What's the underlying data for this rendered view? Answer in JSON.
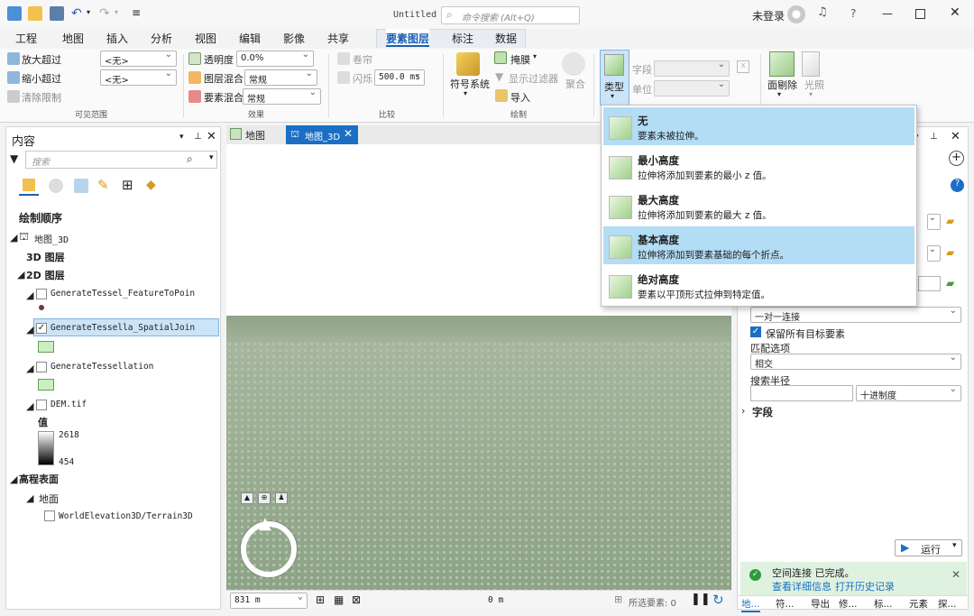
{
  "window": {
    "title": "Untitled",
    "search_placeholder": "命令搜索 (Alt+Q)",
    "user": "未登录"
  },
  "tabs": [
    "工程",
    "地图",
    "插入",
    "分析",
    "视图",
    "编辑",
    "影像",
    "共享",
    "要素图层",
    "标注",
    "数据"
  ],
  "ribbon": {
    "visible_range": {
      "zoom_in": "放大超过",
      "zoom_out": "缩小超过",
      "clear": "清除限制",
      "zoom_in_val": "<无>",
      "zoom_out_val": "<无>",
      "group": "可见范围"
    },
    "effects": {
      "transparency": "透明度",
      "transparency_val": "0.0%",
      "layer_blend": "图层混合",
      "layer_blend_val": "常规",
      "feature_blend": "要素混合",
      "feature_blend_val": "常规",
      "group": "效果"
    },
    "compare": {
      "swipe": "卷帘",
      "flicker": "闪烁",
      "flicker_val": "500.0",
      "flicker_unit": "ms",
      "group": "比较"
    },
    "drawing": {
      "symbology": "符号系统",
      "mask": "掩膜",
      "show_filter": "显示过滤器",
      "import": "导入",
      "aggregate": "聚合",
      "group": "绘制"
    },
    "extrusion": {
      "type": "类型",
      "field": "字段",
      "unit": "单位"
    },
    "faces": {
      "cull": "面剔除",
      "lighting": "光照"
    }
  },
  "contents": {
    "title": "内容",
    "search_placeholder": "搜索",
    "draw_order": "绘制顺序",
    "map": "地图_3D",
    "layers3d": "3D 图层",
    "layers2d": "2D 图层",
    "layer1": "GenerateTessel_FeatureToPoin",
    "layer2": "GenerateTessella_SpatialJoin",
    "layer3": "GenerateTessellation",
    "dem": "DEM.tif",
    "value": "值",
    "high": "2618",
    "low": "454",
    "elev": "高程表面",
    "ground": "地面",
    "terrain": "WorldElevation3D/Terrain3D"
  },
  "view_tabs": {
    "map": "地图",
    "scene": "地图_3D"
  },
  "statusbar": {
    "scale": "831 m",
    "coord": "0 m",
    "selected": "所选要素: 0"
  },
  "extrusion_menu": [
    {
      "title": "无",
      "desc": "要素未被拉伸。"
    },
    {
      "title": "最小高度",
      "desc": "拉伸将添加到要素的最小 z 值。"
    },
    {
      "title": "最大高度",
      "desc": "拉伸将添加到要素的最大 z 值。"
    },
    {
      "title": "基本高度",
      "desc": "拉伸将添加到要素基础的每个折点。"
    },
    {
      "title": "绝对高度",
      "desc": "要素以平顶形式拉伸到特定值。"
    }
  ],
  "geoprocessing": {
    "join_type": "一对一连接",
    "keep_all": "保留所有目标要素",
    "match_option_label": "匹配选项",
    "match_option": "相交",
    "radius_label": "搜索半径",
    "radius_unit": "十进制度",
    "fields": "字段",
    "run": "运行",
    "status": "空间连接 已完成。",
    "details": "查看详细信息",
    "history": "打开历史记录",
    "bottom_tabs": [
      "地...",
      "符...",
      "导出",
      "修...",
      "标...",
      "元素",
      "探..."
    ]
  }
}
